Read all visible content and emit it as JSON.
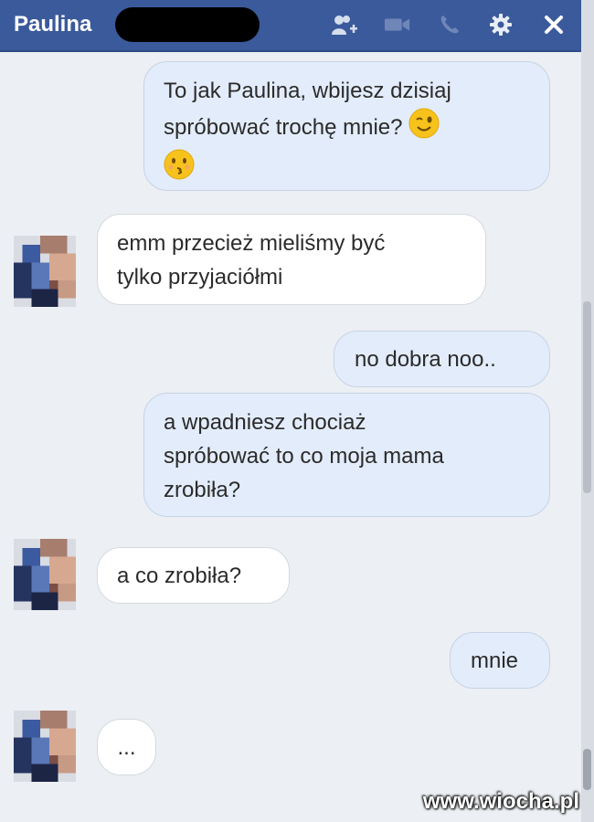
{
  "header": {
    "contact_name": "Paulina",
    "icons": [
      "add-friend-icon",
      "video-call-icon",
      "voice-call-icon",
      "gear-icon",
      "close-icon"
    ],
    "bar_color": "#3b5a9b"
  },
  "messages": [
    {
      "side": "me",
      "lines": [
        "To jak Paulina, wbijesz dzisiaj",
        "spróbować trochę mnie? 😉"
      ],
      "extra_emoji": "😚"
    },
    {
      "side": "them",
      "lines": [
        "emm przecież mieliśmy być",
        "tylko przyjaciółmi"
      ]
    },
    {
      "side": "me",
      "lines": [
        "no dobra noo.."
      ]
    },
    {
      "side": "me",
      "lines": [
        "a wpadniesz chociaż",
        "spróbować to co moja mama",
        "zrobiła?"
      ]
    },
    {
      "side": "them",
      "lines": [
        "a co zrobiła?"
      ]
    },
    {
      "side": "me",
      "lines": [
        "mnie"
      ]
    },
    {
      "side": "them",
      "lines": [
        "..."
      ]
    }
  ],
  "watermark": "www.wiocha.pl",
  "colors": {
    "my_bubble": "#e3ecfa",
    "their_bubble": "#ffffff",
    "background": "#eceff3"
  }
}
